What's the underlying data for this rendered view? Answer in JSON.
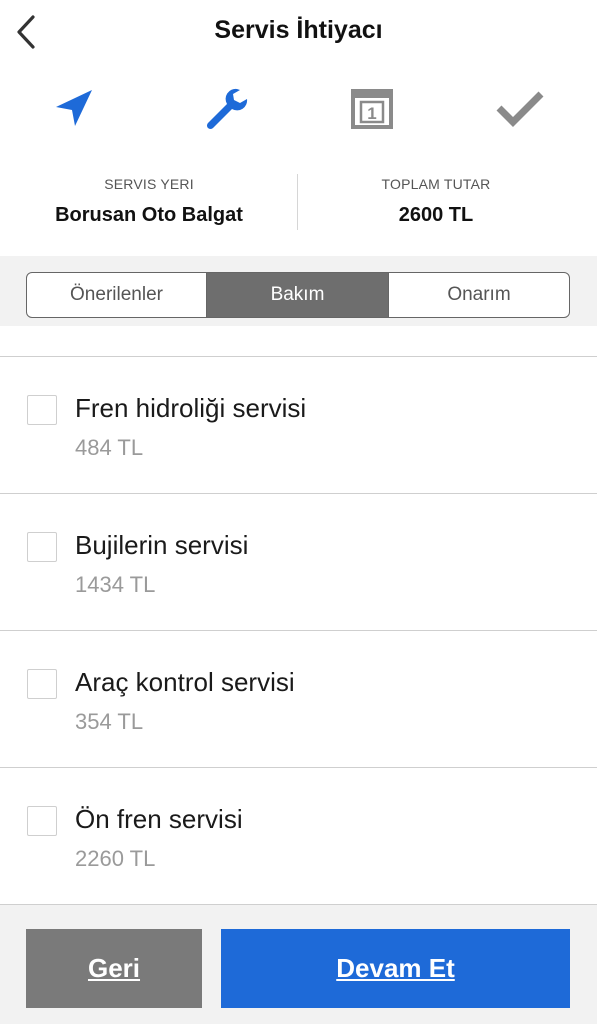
{
  "header": {
    "title": "Servis İhtiyacı"
  },
  "steps": [
    {
      "icon": "location-arrow-icon",
      "color": "#1e6ad8"
    },
    {
      "icon": "wrench-icon",
      "color": "#1e6ad8"
    },
    {
      "icon": "calendar-icon",
      "color": "#8a8a8a",
      "text": "1"
    },
    {
      "icon": "check-icon",
      "color": "#8a8a8a"
    }
  ],
  "summary": {
    "location_label": "SERVIS YERI",
    "location_value": "Borusan Oto Balgat",
    "total_label": "TOPLAM TUTAR",
    "total_value": "2600 TL"
  },
  "tabs": [
    {
      "label": "Önerilenler",
      "active": false
    },
    {
      "label": "Bakım",
      "active": true
    },
    {
      "label": "Onarım",
      "active": false
    }
  ],
  "services": [
    {
      "name": "Fren hidroliği servisi",
      "price": "484 TL",
      "checked": false
    },
    {
      "name": "Bujilerin servisi",
      "price": "1434 TL",
      "checked": false
    },
    {
      "name": "Araç kontrol servisi",
      "price": "354 TL",
      "checked": false
    },
    {
      "name": "Ön fren servisi",
      "price": "2260 TL",
      "checked": false
    }
  ],
  "buttons": {
    "back_label": "Geri",
    "next_label": "Devam Et"
  },
  "colors": {
    "accent": "#1e6ad8",
    "active_tab": "#6e6e6e",
    "inactive_icon": "#8a8a8a",
    "back_button": "#7a7a7a"
  }
}
